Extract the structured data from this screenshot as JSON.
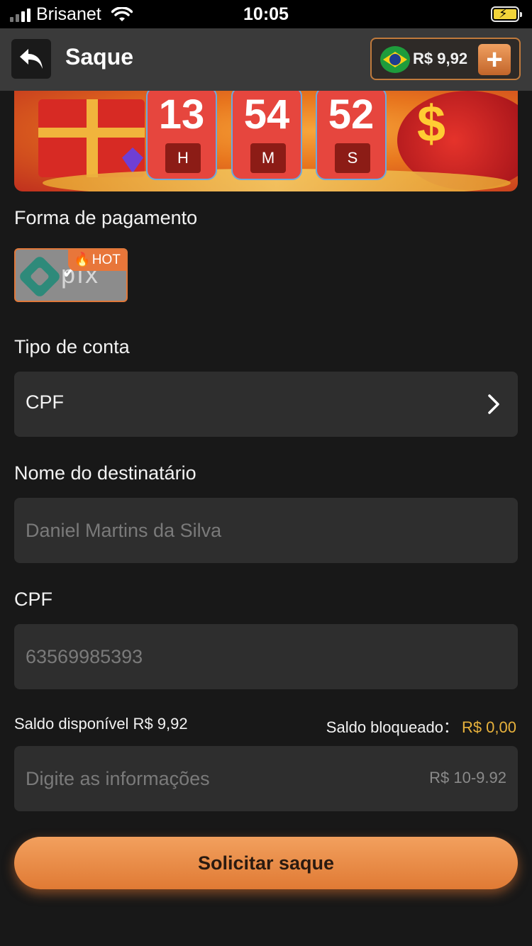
{
  "status_bar": {
    "carrier": "Brisanet",
    "time": "10:05"
  },
  "header": {
    "title": "Saque",
    "balance": "R$ 9,92",
    "add_symbol": "+"
  },
  "banner": {
    "countdown": [
      {
        "value": "13",
        "unit": "H"
      },
      {
        "value": "54",
        "unit": "M"
      },
      {
        "value": "52",
        "unit": "S"
      }
    ],
    "dollar_symbol": "$"
  },
  "payment": {
    "label": "Forma de pagamento",
    "method_name": "pix",
    "hot_label": "HOT"
  },
  "account_type": {
    "label": "Tipo de conta",
    "value": "CPF"
  },
  "recipient": {
    "label": "Nome do destinatário",
    "placeholder": "Daniel Martins da Silva"
  },
  "cpf": {
    "label": "CPF",
    "placeholder": "63569985393"
  },
  "saldo": {
    "disponivel_label": "Saldo disponível R$ 9,92",
    "bloqueado_label": "Saldo bloqueado：",
    "bloqueado_value": "R$ 0,00"
  },
  "amount": {
    "placeholder": "Digite as informações",
    "range_hint": "R$ 10-9.92"
  },
  "submit": {
    "label": "Solicitar saque"
  },
  "colors": {
    "accent": "#e07a34",
    "background": "#181818",
    "field": "#2e2e2e",
    "bloqueado": "#e8b23c"
  }
}
